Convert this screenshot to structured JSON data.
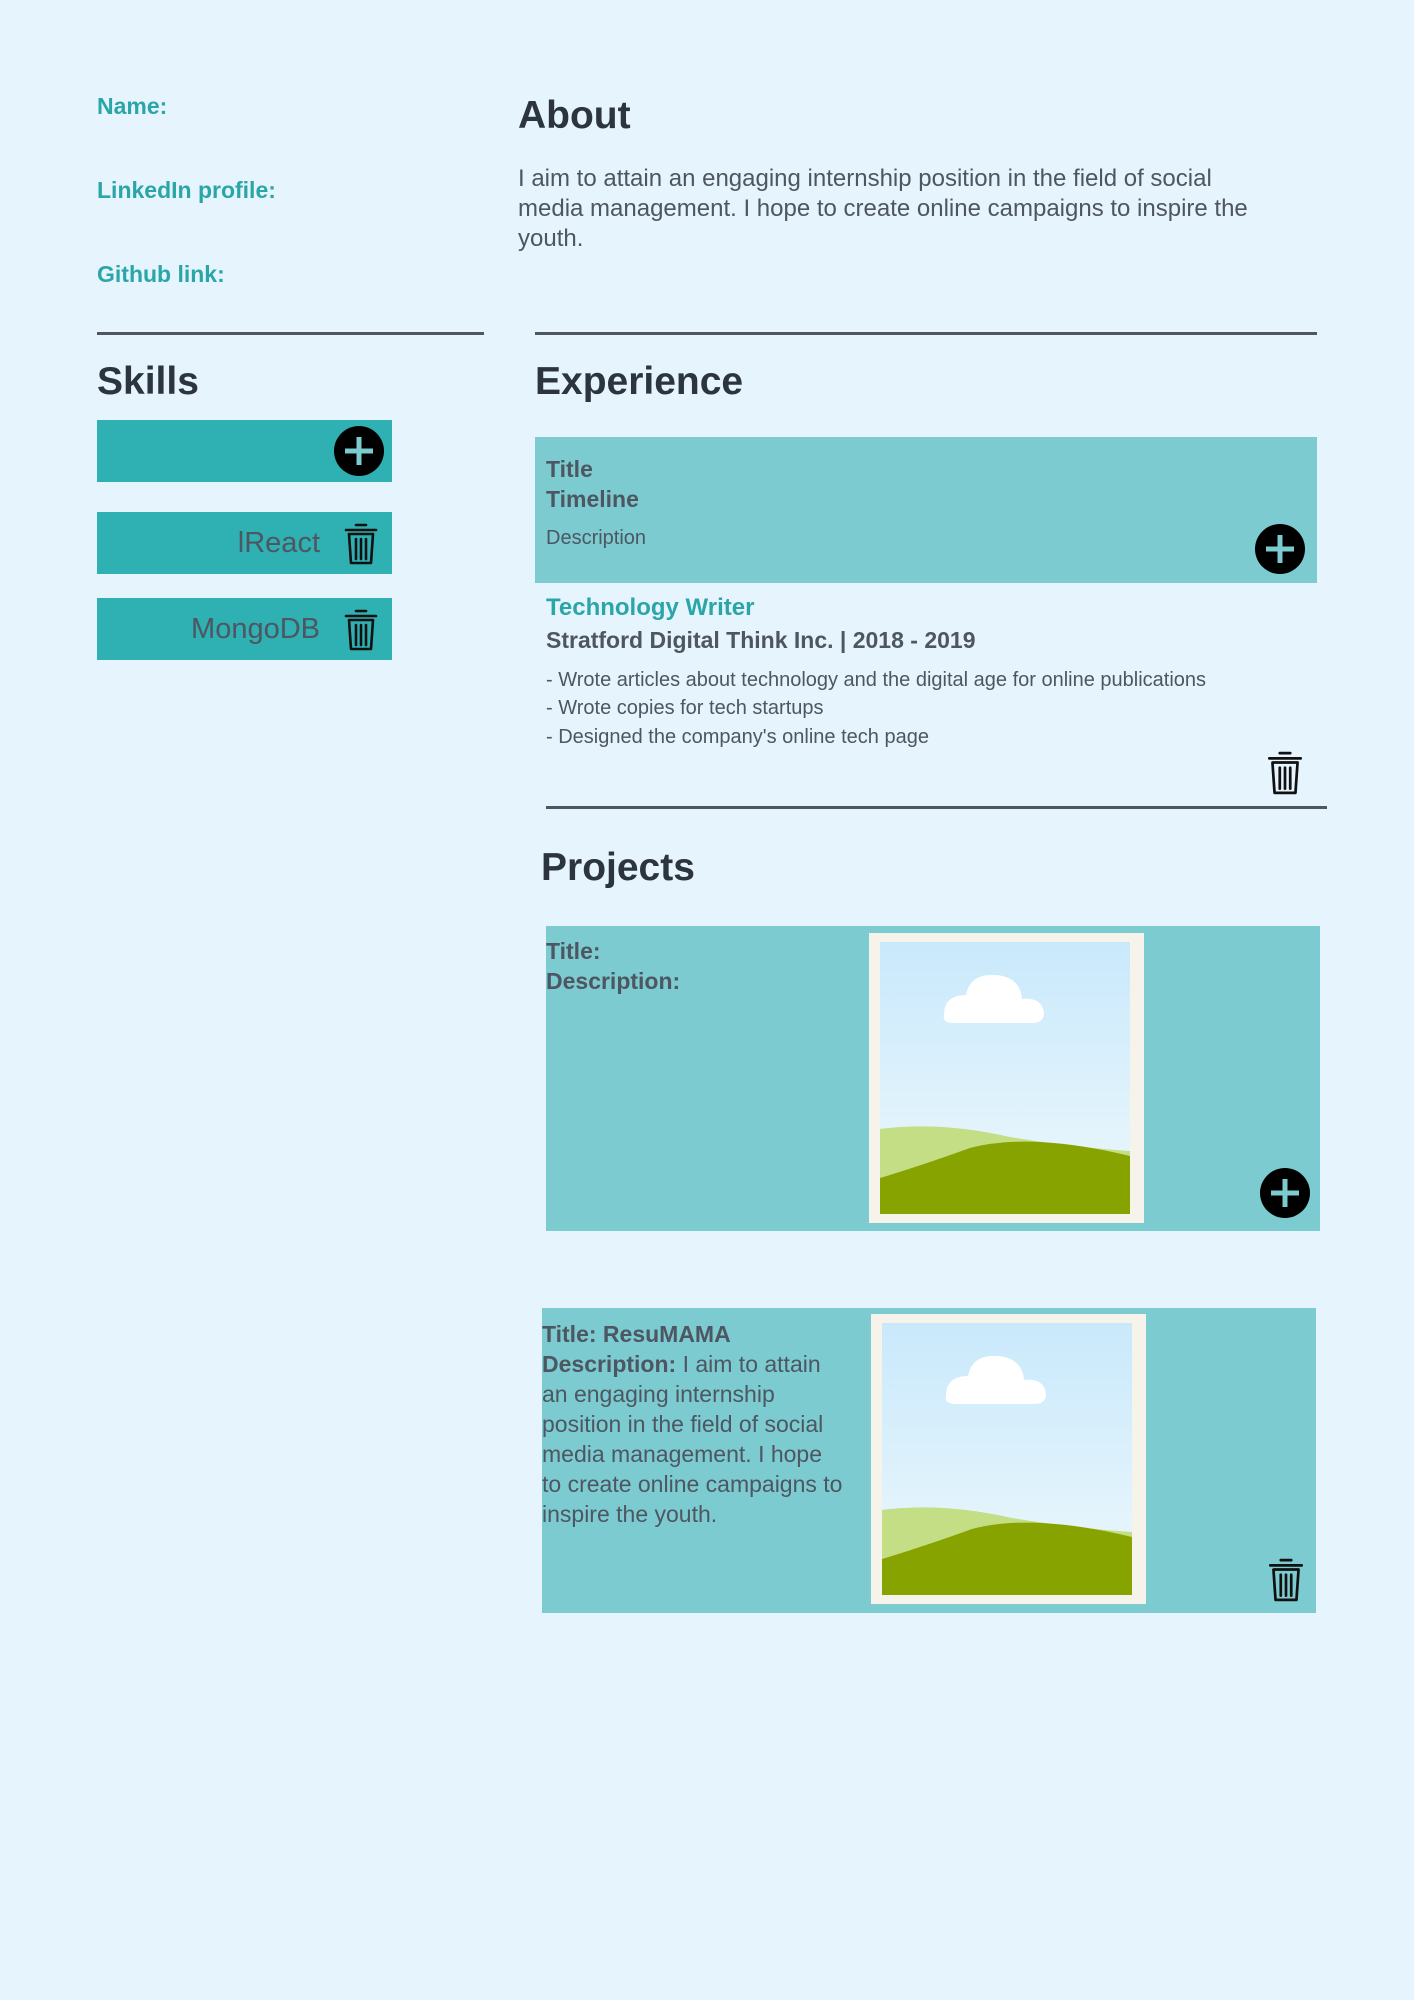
{
  "contact": {
    "name_label": "Name:",
    "linkedin_label": "LinkedIn profile:",
    "github_label": "Github link:"
  },
  "about": {
    "heading": "About",
    "text": "I aim to attain an engaging internship position in the field of social media management. I hope to create online campaigns to inspire the youth."
  },
  "skills": {
    "heading": "Skills",
    "new_skill_value": "",
    "items": [
      {
        "label": "lReact"
      },
      {
        "label": "MongoDB"
      }
    ]
  },
  "experience": {
    "heading": "Experience",
    "form": {
      "title_label": "Title",
      "timeline_label": "Timeline",
      "description_label": "Description"
    },
    "entries": [
      {
        "title": "Technology Writer",
        "company_timeline": "Stratford Digital Think Inc. | 2018 - 2019",
        "bullets": [
          "- Wrote articles about technology and the digital age for online publications",
          "- Wrote copies for tech startups",
          "- Designed the company's online tech page"
        ]
      }
    ]
  },
  "projects": {
    "heading": "Projects",
    "form": {
      "title_label": "Title:",
      "description_label": "Description:"
    },
    "entries": [
      {
        "title_label": "Title: ResuMAMA",
        "description_label": "Description:",
        "description_text": " I aim to attain an engaging internship position in the field of social media management. I hope to create online campaigns to inspire the youth."
      }
    ]
  },
  "icons": {
    "add": "plus-circle-icon",
    "delete": "trash-icon",
    "image": "image-placeholder-icon"
  },
  "colors": {
    "background": "#e6f4fd",
    "accent": "#2aa6a8",
    "skill_bar": "#2fb0b2",
    "panel": "#7ccbd0",
    "text_dark": "#2c3440",
    "text_muted": "#4d5661"
  }
}
